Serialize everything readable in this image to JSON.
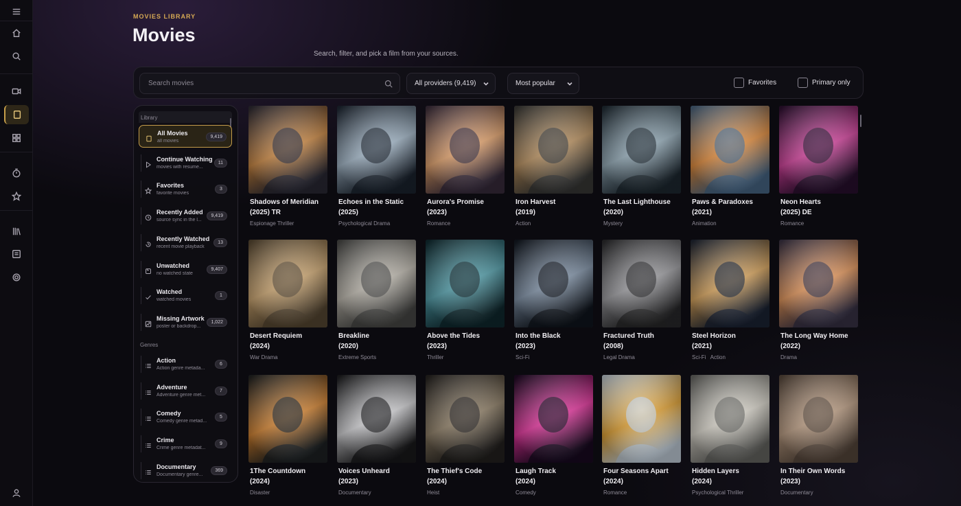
{
  "header": {
    "eyebrow": "MOVIES LIBRARY",
    "title": "Movies",
    "subtitle": "Search, filter, and pick a film from your sources."
  },
  "toolbar": {
    "search_placeholder": "Search movies",
    "provider_select": "All providers (9,419)",
    "sort_select": "Most popular",
    "favorites_label": "Favorites",
    "primary_label": "Primary only"
  },
  "rail": {
    "icons": [
      "menu-icon",
      "home-icon",
      "search-icon",
      "video-icon",
      "movies-icon",
      "grid-icon",
      "timer-icon",
      "star-icon",
      "library-icon",
      "list-icon",
      "settings-icon",
      "user-icon"
    ],
    "active": "movies-icon"
  },
  "sidebar": {
    "library_heading": "Library",
    "genres_heading": "Genres",
    "library_items": [
      {
        "label": "All Movies",
        "sub": "all movies",
        "count": "9,419",
        "icon": "square-icon",
        "active": true
      },
      {
        "label": "Continue Watching",
        "sub": "movies with resume...",
        "count": "11",
        "icon": "play-icon",
        "active": false
      },
      {
        "label": "Favorites",
        "sub": "favorite movies",
        "count": "3",
        "icon": "star-icon",
        "active": false
      },
      {
        "label": "Recently Added",
        "sub": "source sync in the l...",
        "count": "9,419",
        "icon": "clock-icon",
        "active": false
      },
      {
        "label": "Recently Watched",
        "sub": "recent movie playback",
        "count": "13",
        "icon": "history-icon",
        "active": false
      },
      {
        "label": "Unwatched",
        "sub": "no watched state",
        "count": "9,407",
        "icon": "eye-off-icon",
        "active": false
      },
      {
        "label": "Watched",
        "sub": "watched movies",
        "count": "1",
        "icon": "check-icon",
        "active": false
      },
      {
        "label": "Missing Artwork",
        "sub": "poster or backdrop...",
        "count": "1,022",
        "icon": "image-icon",
        "active": false
      }
    ],
    "genre_items": [
      {
        "label": "Action",
        "sub": "Action genre metada...",
        "count": "6"
      },
      {
        "label": "Adventure",
        "sub": "Adventure genre met...",
        "count": "7"
      },
      {
        "label": "Comedy",
        "sub": "Comedy genre metad...",
        "count": "5"
      },
      {
        "label": "Crime",
        "sub": "Crime genre metadat...",
        "count": "9"
      },
      {
        "label": "Documentary",
        "sub": "Documentary genre...",
        "count": "369"
      }
    ]
  },
  "movies": [
    {
      "title": "Shadows of Meridian",
      "year": "(2025) TR",
      "genre": "Espionage Thriller",
      "colors": [
        "#2b2a36",
        "#c7843f"
      ]
    },
    {
      "title": "Echoes in the Static",
      "year": "(2025)",
      "genre": "Psychological Drama",
      "colors": [
        "#1b2430",
        "#9fb3c4"
      ]
    },
    {
      "title": "Aurora's Promise",
      "year": "(2023)",
      "genre": "Romance",
      "colors": [
        "#3a2d3e",
        "#e0a06a"
      ]
    },
    {
      "title": "Iron Harvest",
      "year": "(2019)",
      "genre": "Action",
      "colors": [
        "#3a3a38",
        "#b58d5c"
      ]
    },
    {
      "title": "The Last Lighthouse",
      "year": "(2020)",
      "genre": "Mystery",
      "colors": [
        "#1e2a33",
        "#8fa6b3"
      ]
    },
    {
      "title": "Paws & Paradoxes",
      "year": "(2021)",
      "genre": "Animation",
      "colors": [
        "#4a6a8a",
        "#e08a3a"
      ]
    },
    {
      "title": "Neon Hearts",
      "year": "(2025) DE",
      "genre": "Romance",
      "colors": [
        "#2a1030",
        "#d0409a"
      ]
    },
    {
      "title": "Desert Requiem",
      "year": "(2024)",
      "genre": "War Drama",
      "colors": [
        "#5a4a34",
        "#c9a36e"
      ]
    },
    {
      "title": "Breakline",
      "year": "(2020)",
      "genre": "Extreme Sports",
      "colors": [
        "#4a4a48",
        "#b9b4aa"
      ]
    },
    {
      "title": "Above the Tides",
      "year": "(2023)",
      "genre": "Thriller",
      "colors": [
        "#0f2a30",
        "#4e9aa6"
      ]
    },
    {
      "title": "Into the Black",
      "year": "(2023)",
      "genre": "Sci-Fi",
      "colors": [
        "#10161f",
        "#7c8ea3"
      ]
    },
    {
      "title": "Fractured Truth",
      "year": "(2008)",
      "genre": "Legal Drama",
      "colors": [
        "#2a2a2c",
        "#9a9a9e"
      ]
    },
    {
      "title": "Steel Horizon",
      "year": "(2021)",
      "genre": "Sci-Fi   Action",
      "colors": [
        "#1c2536",
        "#d6a25a"
      ]
    },
    {
      "title": "The Long Way Home",
      "year": "(2022)",
      "genre": "Drama",
      "colors": [
        "#3a3448",
        "#e2955a"
      ]
    },
    {
      "title": "1The Countdown",
      "year": "(2024)",
      "genre": "Disaster",
      "colors": [
        "#1e2224",
        "#d0802e"
      ]
    },
    {
      "title": "Voices Unheard",
      "year": "(2023)",
      "genre": "Documentary",
      "colors": [
        "#1a1a1c",
        "#cfcfd2"
      ]
    },
    {
      "title": "The Thief's Code",
      "year": "(2024)",
      "genre": "Heist",
      "colors": [
        "#252220",
        "#8a7a62"
      ]
    },
    {
      "title": "Laugh Track",
      "year": "(2024)",
      "genre": "Comedy",
      "colors": [
        "#1a0a22",
        "#e0329a"
      ]
    },
    {
      "title": "Four Seasons Apart",
      "year": "(2024)",
      "genre": "Romance",
      "colors": [
        "#c9d6e2",
        "#e0a030"
      ]
    },
    {
      "title": "Hidden Layers",
      "year": "(2024)",
      "genre": "Psychological Thriller",
      "colors": [
        "#6a6a66",
        "#d6d2c8"
      ]
    },
    {
      "title": "In Their Own Words",
      "year": "(2023)",
      "genre": "Documentary",
      "colors": [
        "#5a4a3e",
        "#b89a80"
      ]
    }
  ]
}
